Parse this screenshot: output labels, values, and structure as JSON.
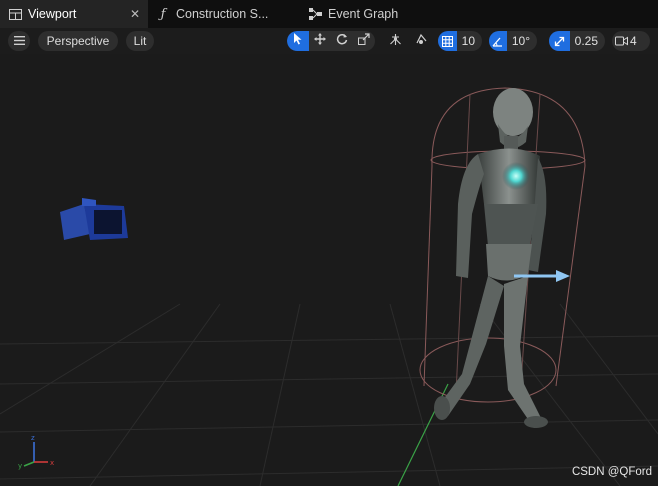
{
  "tabs": [
    {
      "label": "Viewport",
      "icon": "viewport-grid-icon",
      "active": true,
      "close": "✕"
    },
    {
      "label": "Construction S...",
      "icon": "function-icon"
    },
    {
      "label": "Event Graph",
      "icon": "event-graph-icon"
    }
  ],
  "toolbar": {
    "menu_icon": "hamburger-icon",
    "view_mode": "Perspective",
    "lighting": "Lit",
    "grid_snap": "10",
    "rotation_snap": "10°",
    "scale_snap": "0.25",
    "camera_speed": "4"
  },
  "viewport": {
    "background": "#1b1b1b",
    "grid_color": "#2c2c2c",
    "capsule_color": "#8a5a5a",
    "arrow_color": "#8fc6f2"
  },
  "watermark": "CSDN @QFord"
}
